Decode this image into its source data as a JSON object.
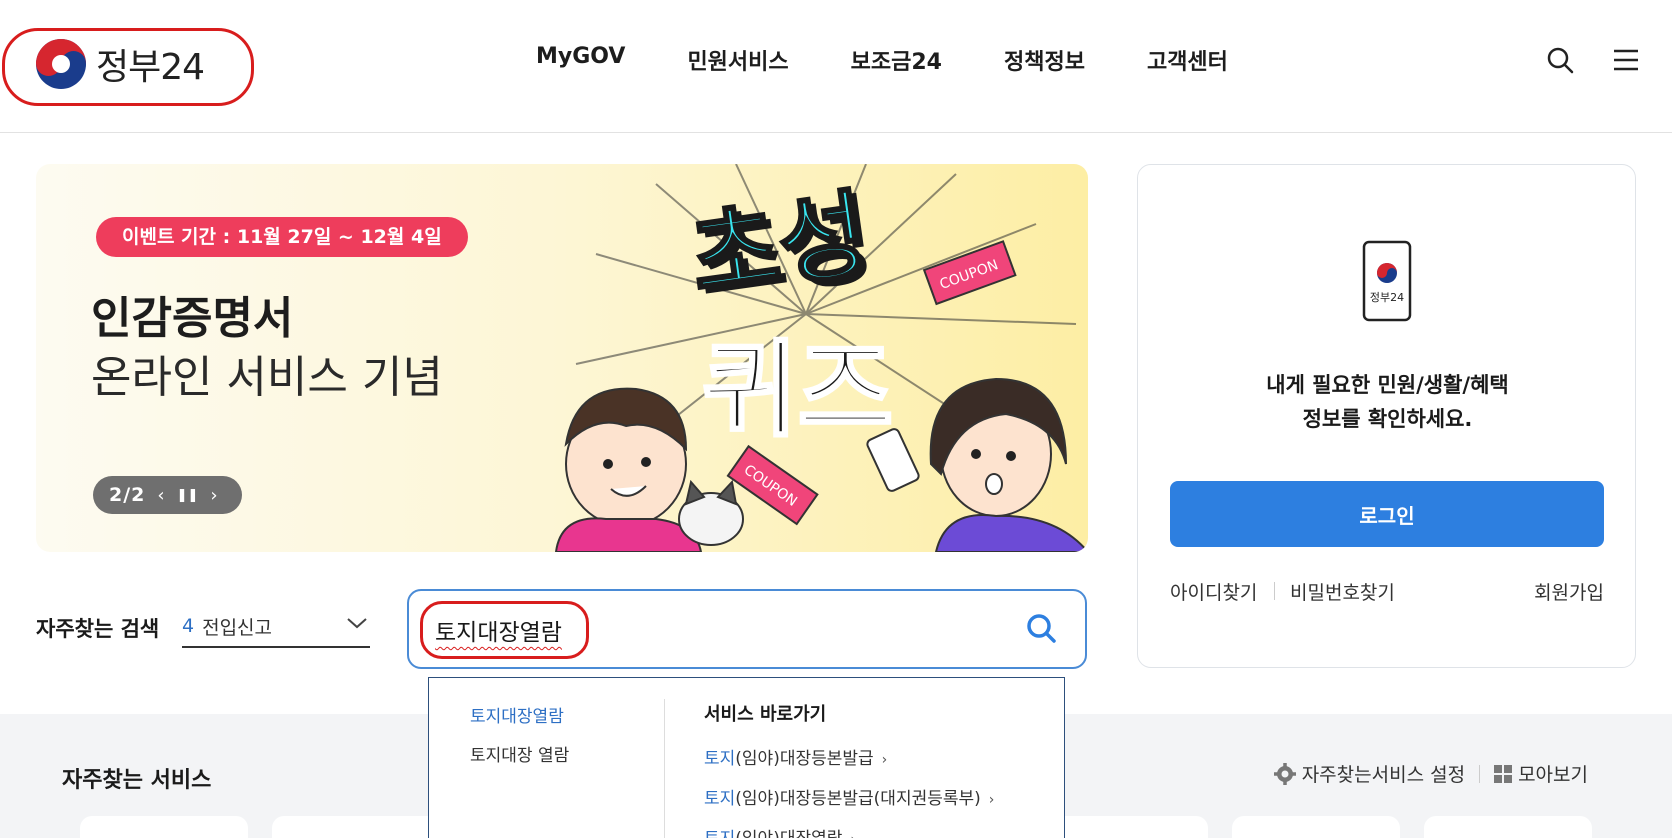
{
  "header": {
    "logo_text": "정부24",
    "nav": [
      "MyGOV",
      "민원서비스",
      "보조금24",
      "정책정보",
      "고객센터"
    ]
  },
  "banner": {
    "event_period": "이벤트 기간 : 11월 27일 ~ 12월 4일",
    "title": "인감증명서",
    "subtitle": "온라인 서비스 기념",
    "slide_counter": "2/2",
    "art_headline": [
      "초성",
      "퀴즈"
    ],
    "coupon_label": "COUPON"
  },
  "frequent_search": {
    "label": "자주찾는 검색",
    "selected_rank": "4",
    "selected_value": "전입신고"
  },
  "search": {
    "value": "토지대장열람"
  },
  "autocomplete": {
    "suggestions": [
      "토지대장열람",
      "토지대장 열람"
    ],
    "shortcut_title": "서비스 바로가기",
    "shortcuts": [
      {
        "highlight": "토지",
        "rest": "(임야)대장등본발급"
      },
      {
        "highlight": "토지",
        "rest": "(임야)대장등본발급(대지권등록부)"
      },
      {
        "highlight": "토지",
        "rest": "(임야)대장열람"
      }
    ]
  },
  "login_card": {
    "phone_label": "정부24",
    "message_line1": "내게 필요한 민원/생활/혜택",
    "message_line2": "정보를 확인하세요.",
    "login_button": "로그인",
    "find_id": "아이디찾기",
    "find_password": "비밀번호찾기",
    "join": "회원가입"
  },
  "frequent_services": {
    "title": "자주찾는 서비스",
    "settings_label": "자주찾는서비스 설정",
    "view_all_label": "모아보기"
  },
  "colors": {
    "accent_blue": "#2d7fe0",
    "event_pink": "#ee3d5c",
    "highlight_red": "#d81d1d",
    "search_border": "#4a8bd6"
  }
}
